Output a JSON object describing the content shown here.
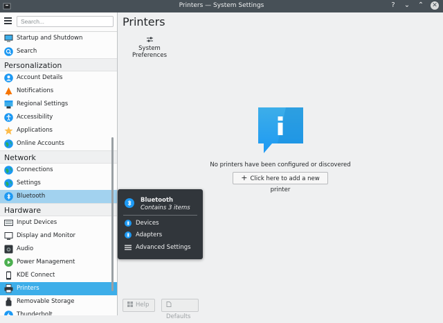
{
  "window": {
    "title": "Printers — System Settings",
    "controls": [
      "?",
      "⌄",
      "⌃",
      "✕"
    ]
  },
  "sidebar": {
    "search_placeholder": "Search...",
    "rows": [
      {
        "kind": "item",
        "label": "Startup and Shutdown",
        "icon": "monitor-icon"
      },
      {
        "kind": "item",
        "label": "Search",
        "icon": "search-icon"
      },
      {
        "kind": "category",
        "label": "Personalization"
      },
      {
        "kind": "item",
        "label": "Account Details",
        "icon": "account-icon"
      },
      {
        "kind": "item",
        "label": "Notifications",
        "icon": "bell-icon"
      },
      {
        "kind": "item",
        "label": "Regional Settings",
        "icon": "regional-icon"
      },
      {
        "kind": "item",
        "label": "Accessibility",
        "icon": "accessibility-icon"
      },
      {
        "kind": "item",
        "label": "Applications",
        "icon": "star-icon"
      },
      {
        "kind": "item",
        "label": "Online Accounts",
        "icon": "globe-icon"
      },
      {
        "kind": "category",
        "label": "Network"
      },
      {
        "kind": "item",
        "label": "Connections",
        "icon": "globe-icon"
      },
      {
        "kind": "item",
        "label": "Settings",
        "icon": "globe-icon"
      },
      {
        "kind": "item",
        "label": "Bluetooth",
        "icon": "bluetooth-icon",
        "state": "hover"
      },
      {
        "kind": "category",
        "label": "Hardware"
      },
      {
        "kind": "item",
        "label": "Input Devices",
        "icon": "keyboard-icon"
      },
      {
        "kind": "item",
        "label": "Display and Monitor",
        "icon": "display-icon"
      },
      {
        "kind": "item",
        "label": "Audio",
        "icon": "speaker-icon"
      },
      {
        "kind": "item",
        "label": "Power Management",
        "icon": "power-icon"
      },
      {
        "kind": "item",
        "label": "KDE Connect",
        "icon": "phone-icon"
      },
      {
        "kind": "item",
        "label": "Printers",
        "icon": "printer-icon",
        "state": "selected"
      },
      {
        "kind": "item",
        "label": "Removable Storage",
        "icon": "usb-icon"
      },
      {
        "kind": "item",
        "label": "Thunderbolt",
        "icon": "thunderbolt-icon"
      }
    ]
  },
  "main": {
    "title": "Printers",
    "system_preferences": "System Preferences",
    "empty_message": "No printers have been configured or discovered",
    "add_button": "Click here to add a new printer",
    "help_button": "Help",
    "defaults_button": "Defaults"
  },
  "popup": {
    "title": "Bluetooth",
    "subtitle": "Contains 3 items",
    "items": [
      {
        "label": "Devices",
        "icon": "bluetooth-icon"
      },
      {
        "label": "Adapters",
        "icon": "bluetooth-icon"
      },
      {
        "label": "Advanced Settings",
        "icon": "menu-icon"
      }
    ]
  },
  "colors": {
    "accent": "#3daee9",
    "hover": "#a2d2ef",
    "titlebar": "#475057",
    "popup_bg": "#31363b"
  }
}
